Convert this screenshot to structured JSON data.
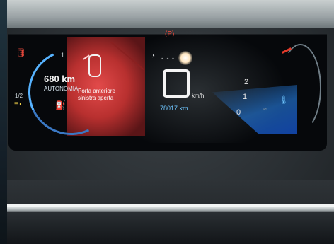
{
  "cluster": {
    "range_value": "680 km",
    "range_label": "AUTONOMIA",
    "fuel_half": "1/2",
    "fuel_full": "1",
    "alert_line1": "Porta anteriore",
    "alert_line2": "sinistra aperta",
    "speed_unit": "km/h",
    "odometer": "78017 km",
    "gauge_2": "2",
    "gauge_1": "1",
    "gauge_0": "0",
    "cruise_dash": "- - -"
  },
  "icons": {
    "oil": "oil-pressure-icon",
    "lights": "headlight-icon",
    "fuel": "fuel-pump-icon",
    "brake": "parking-brake-icon",
    "door": "open-door-car-icon",
    "cruise": "cruise-gauge-icon",
    "coolant": "coolant-temperature-icon"
  },
  "colors": {
    "alert_red": "#e24a4a",
    "accent_blue": "#57b3ff",
    "odometer_blue": "#6fc6ff"
  }
}
